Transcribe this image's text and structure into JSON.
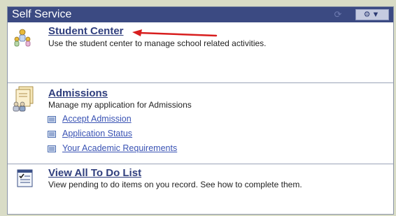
{
  "panel": {
    "title": "Self Service",
    "refresh_icon": "refresh-icon",
    "options_icon": "gear-dropdown-icon"
  },
  "items": [
    {
      "title": "Student Center",
      "description": "Use the student center to manage school related activities.",
      "icon": "student-center-icon"
    },
    {
      "title": "Admissions",
      "description": "Manage my application for Admissions",
      "icon": "admissions-icon",
      "links": [
        {
          "label": "Accept Admission"
        },
        {
          "label": "Application Status"
        },
        {
          "label": "Your Academic Requirements"
        }
      ]
    },
    {
      "title": "View All To Do List",
      "description": "View pending to do items on you record. See how to complete them.",
      "icon": "checklist-icon"
    }
  ],
  "colors": {
    "header": "#3b4a82",
    "link": "#2f3e7d",
    "annotation_arrow": "#d81e1e"
  }
}
